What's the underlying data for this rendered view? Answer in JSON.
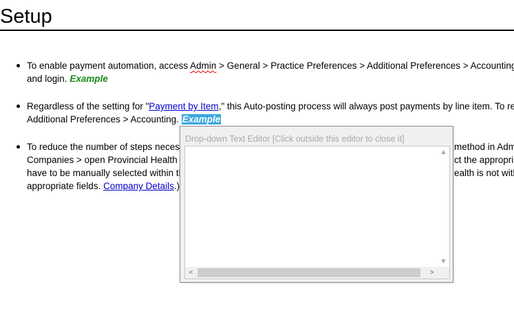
{
  "page": {
    "title": "Setup"
  },
  "bullets": {
    "b1": {
      "line1_prefix": "To enable payment automation, access ",
      "admin_word": "Admin",
      "line1_suffix": " > General > Practice Preferences > Additional Preferences > Accounting >",
      "line2_text": "and login. ",
      "example": "Example"
    },
    "b2": {
      "line1_prefix": "Regardless of the setting for \"",
      "link": "Payment by Item",
      "line1_suffix": ",\" this Auto-posting process will always post payments by line item. To revie",
      "line2_text": "Additional Preferences > Accounting.  ",
      "example": "Example"
    },
    "b3": {
      "line1_left": "To reduce the number of steps necess",
      "line1_right": "method in Admi",
      "line2_left": "Companies > open Provincial Health >",
      "line2_right": "ct the appropria",
      "line3_left": "have to be manually selected within the",
      "line3_right": "ealth is not with",
      "line4_prefix": "appropriate fields. ",
      "link": "Company Details",
      "line4_suffix": ".)"
    }
  },
  "editor": {
    "title": "Drop-down Text Editor [Click outside this editor to close it]",
    "value": "",
    "icons": {
      "up": "▲",
      "down": "▼",
      "left": "<",
      "right": ">"
    }
  },
  "colors": {
    "link": "#0000cc",
    "example": "#1a8a1a",
    "selection": "#3aa7e0"
  }
}
